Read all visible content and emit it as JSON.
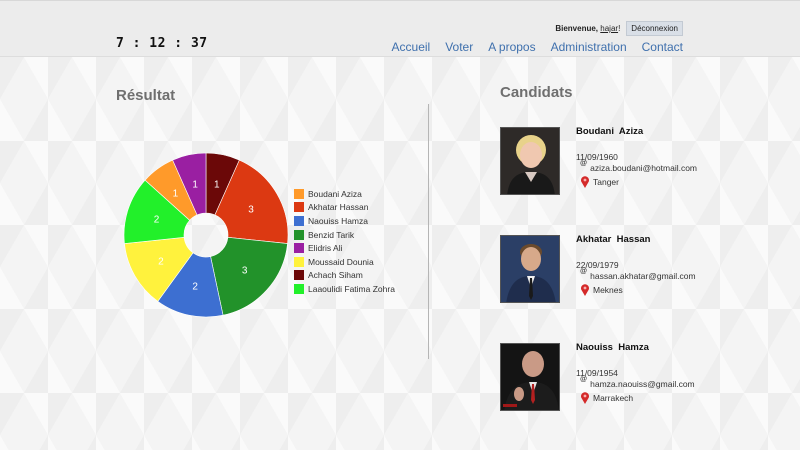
{
  "header": {
    "clock": "7 : 12 : 37",
    "welcome_label": "Bienvenue,",
    "username": "hajar",
    "username_suffix": "!",
    "logout_label": "Déconnexion",
    "nav": [
      "Accueil",
      "Voter",
      "A propos",
      "Administration",
      "Contact"
    ],
    "nav_color": "#3f70ad"
  },
  "results": {
    "title": "Résultat"
  },
  "candidates_section": {
    "title": "Candidats"
  },
  "chart_data": {
    "type": "pie",
    "donut": true,
    "categories": [
      "Boudani Aziza",
      "Akhatar Hassan",
      "Naouiss Hamza",
      "Benzid Tarik",
      "Elidris Ali",
      "Moussaid Dounia",
      "Achach Siham",
      "Laaoulidi Fatima Zohra"
    ],
    "values": [
      1,
      3,
      3,
      2,
      2,
      2,
      1,
      1
    ],
    "series": [
      {
        "name": "Achach Siham",
        "value": 1,
        "color": "#6b0808"
      },
      {
        "name": "Akhatar Hassan",
        "value": 3,
        "color": "#dc3912"
      },
      {
        "name": "Benzid Tarik",
        "value": 3,
        "color": "#22922a"
      },
      {
        "name": "Naouiss Hamza",
        "value": 2,
        "color": "#3d6fd1"
      },
      {
        "name": "Moussaid Dounia",
        "value": 2,
        "color": "#fff23d"
      },
      {
        "name": "Laaoulidi Fatima Zohra",
        "value": 2,
        "color": "#22f02a"
      },
      {
        "name": "Boudani Aziza",
        "value": 1,
        "color": "#ff9a2a"
      },
      {
        "name": "Elidris Ali",
        "value": 1,
        "color": "#9a1fa2"
      }
    ],
    "legend": [
      {
        "name": "Boudani Aziza",
        "color": "#ff9a2a"
      },
      {
        "name": "Akhatar Hassan",
        "color": "#dc3912"
      },
      {
        "name": "Naouiss Hamza",
        "color": "#3d6fd1"
      },
      {
        "name": "Benzid Tarik",
        "color": "#22922a"
      },
      {
        "name": "Elidris Ali",
        "color": "#9a1fa2"
      },
      {
        "name": "Moussaid Dounia",
        "color": "#fff23d"
      },
      {
        "name": "Achach Siham",
        "color": "#6b0808"
      },
      {
        "name": "Laaoulidi Fatima Zohra",
        "color": "#22f02a"
      }
    ],
    "legend_position": "right"
  },
  "candidates": [
    {
      "name": "Boudani  Aziza",
      "birthdate": "11/09/1960",
      "email": "aziza.boudani@hotmail.com",
      "city": "Tanger",
      "photo_icon": "woman-portrait"
    },
    {
      "name": "Akhatar  Hassan",
      "birthdate": "22/09/1979",
      "email": "hassan.akhatar@gmail.com",
      "city": "Meknes",
      "photo_icon": "man-portrait"
    },
    {
      "name": "Naouiss  Hamza",
      "birthdate": "11/09/1954",
      "email": "hamza.naouiss@gmail.com",
      "city": "Marrakech",
      "photo_icon": "man-portrait"
    }
  ]
}
